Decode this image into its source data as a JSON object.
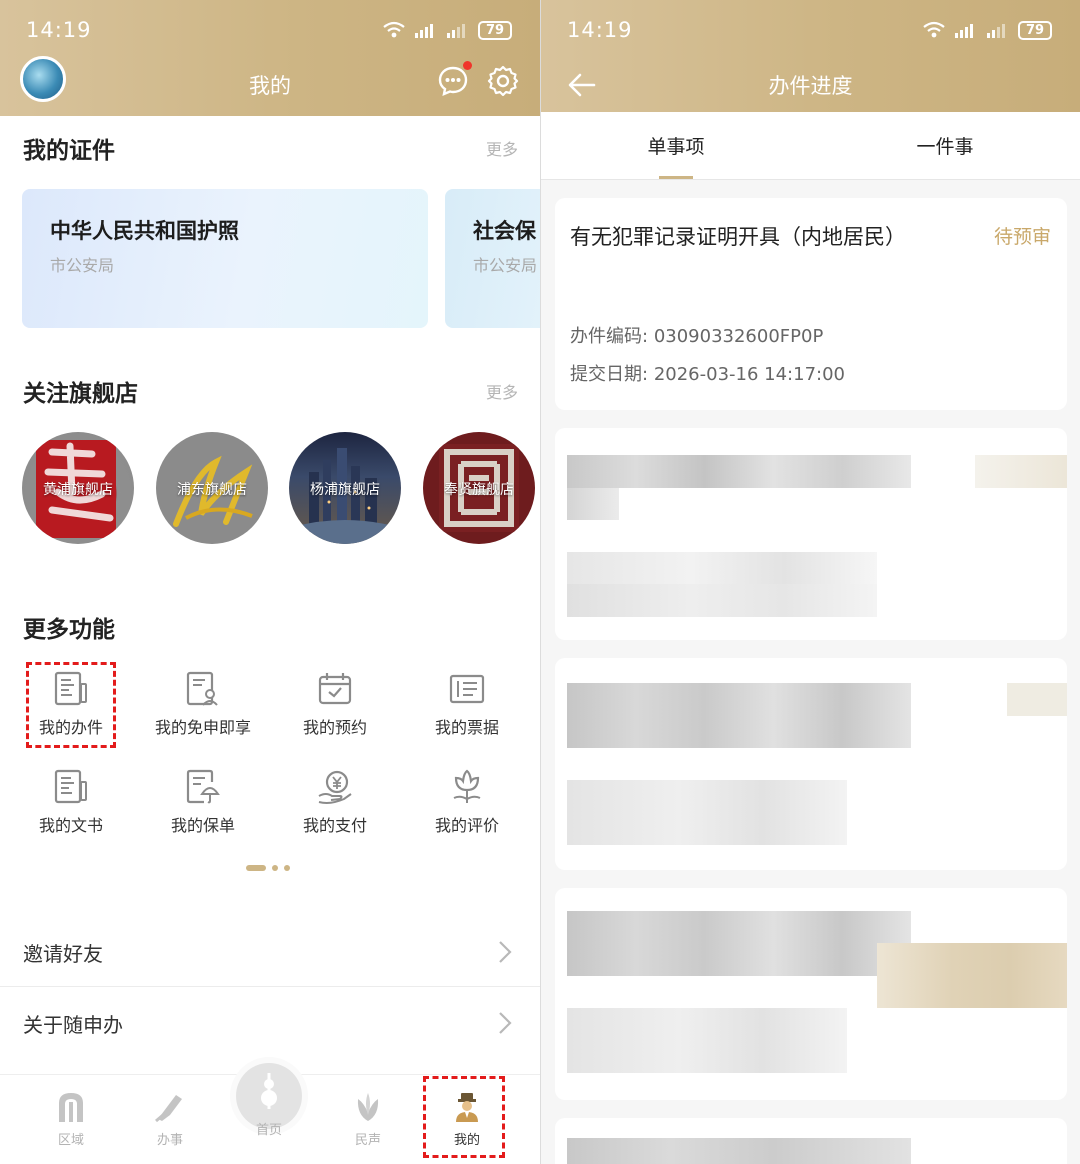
{
  "status_bar": {
    "time": "14:19",
    "battery": "79"
  },
  "left": {
    "nav_title": "我的",
    "certificates": {
      "title": "我的证件",
      "more": "更多",
      "cards": [
        {
          "name": "中华人民共和国护照",
          "org": "市公安局"
        },
        {
          "name": "社会保",
          "org": "市公安局"
        }
      ]
    },
    "stores": {
      "title": "关注旗舰店",
      "more": "更多",
      "items": [
        {
          "label": "黄浦旗舰店"
        },
        {
          "label": "浦东旗舰店"
        },
        {
          "label": "杨浦旗舰店"
        },
        {
          "label": "奉贤旗舰店"
        }
      ]
    },
    "functions": {
      "title": "更多功能",
      "items": [
        {
          "label": "我的办件",
          "icon": "document-icon"
        },
        {
          "label": "我的免申即享",
          "icon": "form-user-icon"
        },
        {
          "label": "我的预约",
          "icon": "calendar-check-icon"
        },
        {
          "label": "我的票据",
          "icon": "receipt-icon"
        },
        {
          "label": "我的文书",
          "icon": "document-pen-icon"
        },
        {
          "label": "我的保单",
          "icon": "policy-umbrella-icon"
        },
        {
          "label": "我的支付",
          "icon": "yuan-hand-icon"
        },
        {
          "label": "我的评价",
          "icon": "flower-icon"
        }
      ]
    },
    "rows": [
      {
        "label": "邀请好友"
      },
      {
        "label": "关于随申办"
      }
    ],
    "tabbar": [
      {
        "label": "区域",
        "icon": "arch-icon"
      },
      {
        "label": "办事",
        "icon": "pen-icon"
      },
      {
        "label": "首页",
        "icon": "tower-icon"
      },
      {
        "label": "民声",
        "icon": "magnolia-icon"
      },
      {
        "label": "我的",
        "icon": "person-icon"
      }
    ],
    "highlight_color": "#e31b1b"
  },
  "right": {
    "nav_title": "办件进度",
    "tabs": [
      {
        "label": "单事项",
        "active": true
      },
      {
        "label": "一件事",
        "active": false
      }
    ],
    "case": {
      "title": "有无犯罪记录证明开具（内地居民）",
      "status": "待预审",
      "code_label": "办件编码:",
      "code": "03090332600FP0P",
      "date_label": "提交日期:",
      "date": "2026-03-16 14:17:00"
    }
  },
  "colors": {
    "gold": "#cdb585",
    "status_gold": "#c9a86a"
  }
}
